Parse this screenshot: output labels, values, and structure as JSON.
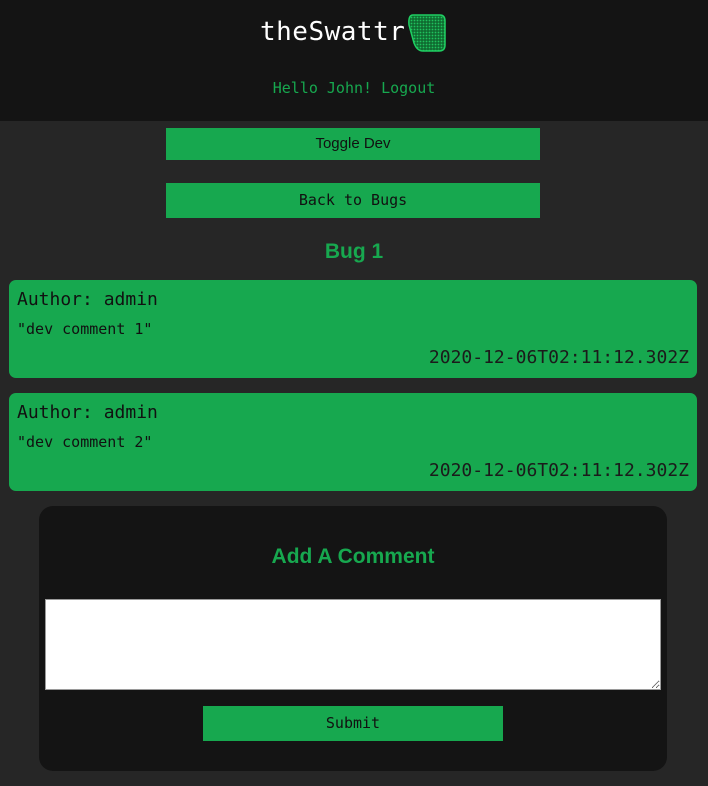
{
  "header": {
    "logo_text": "theSwattr",
    "logo_icon": "swatter-icon",
    "greeting_prefix": "Hello John! ",
    "logout_label": "Logout"
  },
  "controls": {
    "toggle_dev_label": "Toggle Dev",
    "back_label": "Back to Bugs"
  },
  "bug": {
    "title": "Bug 1"
  },
  "comments": [
    {
      "author": "Author: admin",
      "body": "\"dev comment 1\"",
      "date": "2020-12-06T02:11:12.302Z"
    },
    {
      "author": "Author: admin",
      "body": "\"dev comment 2\"",
      "date": "2020-12-06T02:11:12.302Z"
    }
  ],
  "add_comment": {
    "title": "Add A Comment",
    "input_value": "",
    "submit_label": "Submit"
  },
  "colors": {
    "accent": "#17a84f",
    "header_bg": "#141414",
    "page_bg": "#262626"
  }
}
